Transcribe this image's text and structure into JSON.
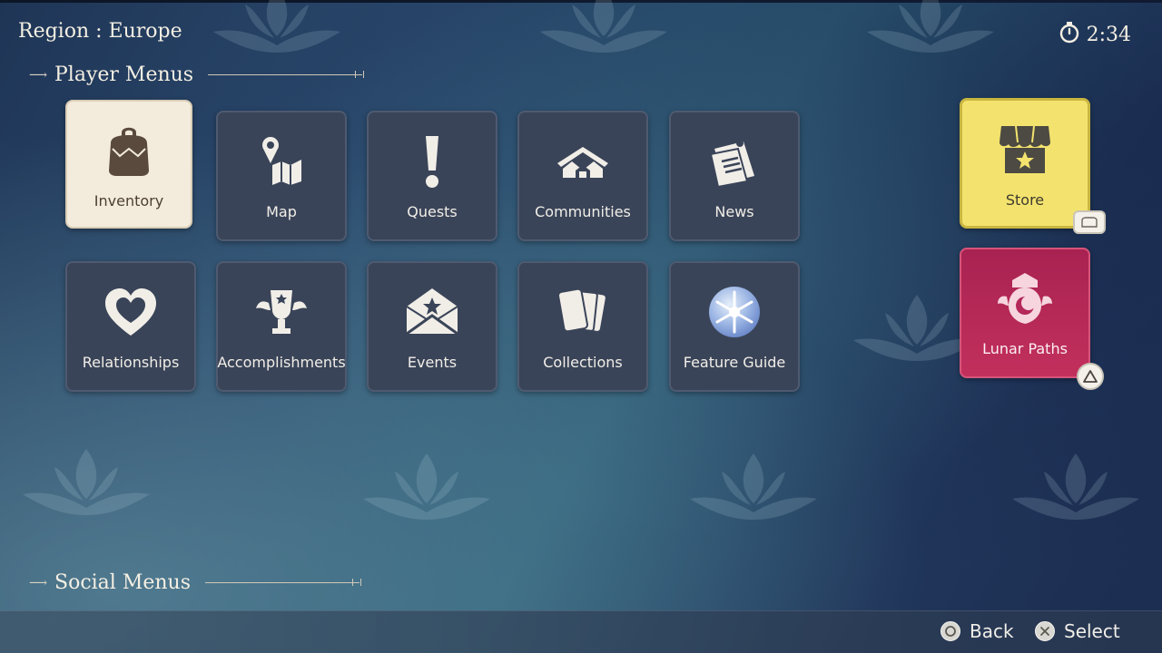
{
  "header": {
    "region_label": "Region : Europe",
    "timer": "2:34",
    "timer_icon": "stopwatch-icon"
  },
  "sections": {
    "player_menus": "Player Menus",
    "social_menus": "Social Menus"
  },
  "menu_tiles": [
    {
      "label": "Inventory",
      "icon": "backpack-icon",
      "selected": true
    },
    {
      "label": "Map",
      "icon": "map-icon"
    },
    {
      "label": "Quests",
      "icon": "exclamation-icon"
    },
    {
      "label": "Communities",
      "icon": "houses-icon"
    },
    {
      "label": "News",
      "icon": "newspaper-icon"
    },
    {
      "label": "Relationships",
      "icon": "heart-icon"
    },
    {
      "label": "Accomplishments",
      "icon": "trophy-icon"
    },
    {
      "label": "Events",
      "icon": "envelope-star-icon"
    },
    {
      "label": "Collections",
      "icon": "cards-icon"
    },
    {
      "label": "Feature Guide",
      "icon": "snowflake-orb-icon"
    }
  ],
  "side_tiles": {
    "store": {
      "label": "Store",
      "icon": "shop-icon",
      "color": "#f3e36e"
    },
    "lunar_paths": {
      "label": "Lunar Paths",
      "icon": "moon-crest-icon",
      "color": "#b4285a"
    }
  },
  "footer": {
    "back_label": "Back",
    "select_label": "Select"
  }
}
